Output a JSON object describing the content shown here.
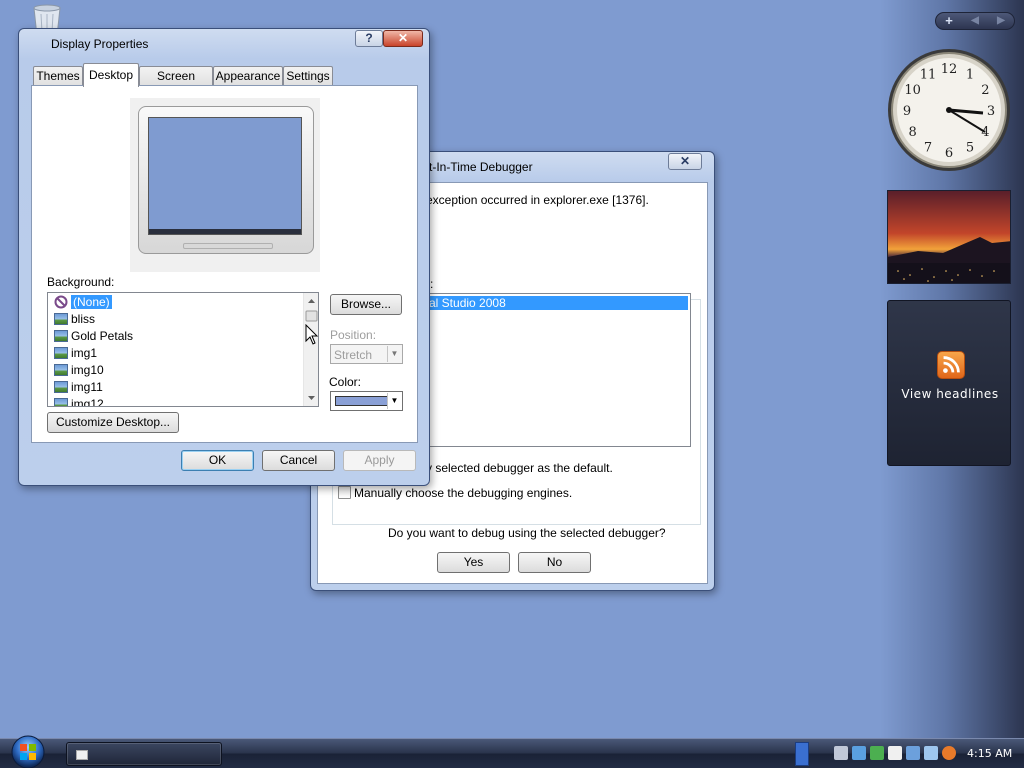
{
  "desktop": {
    "recycle_bin_icon": "recycle-bin-icon"
  },
  "sidebar": {
    "controls": {
      "add": "+",
      "prev": "◀",
      "next": "▶"
    },
    "clock_numbers": [
      "12",
      "1",
      "2",
      "3",
      "4",
      "5",
      "6",
      "7",
      "8",
      "9",
      "10",
      "11"
    ],
    "feed_label": "View headlines"
  },
  "jit_debugger": {
    "title": "st-In-Time Debugger",
    "close": "✕",
    "message": "exception occurred in explorer.exe [1376].",
    "list_label_fragment": "s:",
    "list_items": [
      "tual Studio 2008"
    ],
    "checkbox_default_label": "y selected debugger as the default.",
    "checkbox_manual_label": "Manually choose the debugging engines.",
    "question": "Do you want to debug using the selected debugger?",
    "yes": "Yes",
    "no": "No"
  },
  "display_properties": {
    "title": "Display Properties",
    "help": "?",
    "close": "✕",
    "tabs": [
      "Themes",
      "Desktop",
      "Screen Saver",
      "Appearance",
      "Settings"
    ],
    "active_tab": "Desktop",
    "background_label": "Background:",
    "background_items": [
      "(None)",
      "bliss",
      "Gold Petals",
      "img1",
      "img10",
      "img11",
      "img12"
    ],
    "selected_background": "(None)",
    "browse": "Browse...",
    "position_label": "Position:",
    "position_value": "Stretch",
    "color_label": "Color:",
    "color_value": "#8aa0d6",
    "customize": "Customize Desktop...",
    "ok": "OK",
    "cancel": "Cancel",
    "apply": "Apply"
  },
  "taskbar": {
    "time": "4:15 AM",
    "tray_colors": [
      "#c0c8d8",
      "#5aa0e0",
      "#4caf50",
      "#f0f0f0",
      "#6ca0dc",
      "#9ec6ee",
      "#e87a2a"
    ]
  },
  "colors": {
    "desktop": "#7f9bd0",
    "selection": "#3399ff",
    "feed_orange": "#e0661a"
  }
}
